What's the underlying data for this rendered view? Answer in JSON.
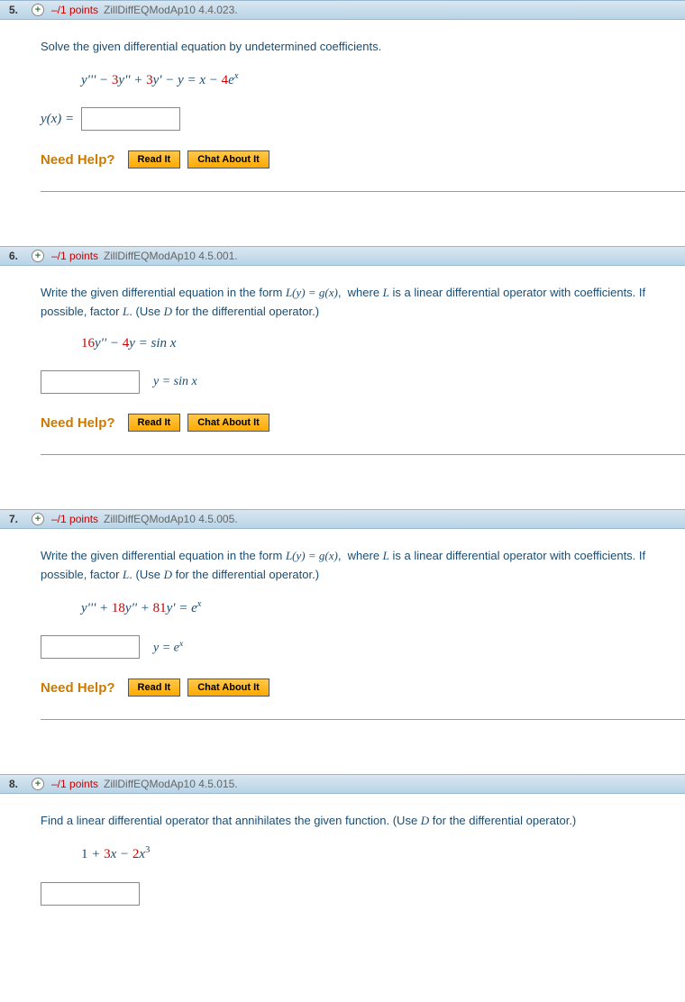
{
  "help": {
    "label": "Need Help?",
    "read": "Read It",
    "chat": "Chat About It"
  },
  "questions": [
    {
      "num": "5.",
      "points": "–/1 points",
      "ref": "ZillDiffEQModAp10 4.4.023.",
      "prompt": "Solve the given differential equation by undetermined coefficients.",
      "equation_html": "y''' − <span class='n1'>3</span>y'' + <span class='n1'>3</span>y' − y = x − <span class='n1'>4</span>e<sup>x</sup>",
      "answer_prefix": "y(x) =",
      "answer_suffix": ""
    },
    {
      "num": "6.",
      "points": "–/1 points",
      "ref": "ZillDiffEQModAp10 4.5.001.",
      "prompt": "Write the given differential equation in the form <i style='font-family:Times'>L(y) = g(x)</i>,&nbsp; where <i style='font-family:Times'>L</i> is a linear differential operator with coefficients. If possible, factor <i style='font-family:Times'>L</i>. (Use <i style='font-family:Times'>D</i> for the differential operator.)",
      "equation_html": "<span class='n1'>16</span>y'' − <span class='n1'>4</span>y = sin x",
      "answer_prefix": "",
      "answer_suffix": "y = sin x"
    },
    {
      "num": "7.",
      "points": "–/1 points",
      "ref": "ZillDiffEQModAp10 4.5.005.",
      "prompt": "Write the given differential equation in the form <i style='font-family:Times'>L(y) = g(x)</i>,&nbsp; where <i style='font-family:Times'>L</i> is a linear differential operator with coefficients. If possible, factor <i style='font-family:Times'>L</i>. (Use <i style='font-family:Times'>D</i> for the differential operator.)",
      "equation_html": "y''' + <span class='n1'>18</span>y'' + <span class='n1'>81</span>y' = e<sup>x</sup>",
      "answer_prefix": "",
      "answer_suffix": "y = e<sup>x</sup>"
    },
    {
      "num": "8.",
      "points": "–/1 points",
      "ref": "ZillDiffEQModAp10 4.5.015.",
      "prompt": "Find a linear differential operator that annihilates the given function. (Use <i style='font-family:Times'>D</i> for the differential operator.)",
      "equation_html": "<span style='font-style:normal'>1</span> + <span class='n1'>3</span>x − <span class='n1'>2</span>x<sup class='sup-plain'>3</sup>",
      "answer_prefix": "",
      "answer_suffix": "",
      "no_help": true,
      "partial": true
    }
  ]
}
